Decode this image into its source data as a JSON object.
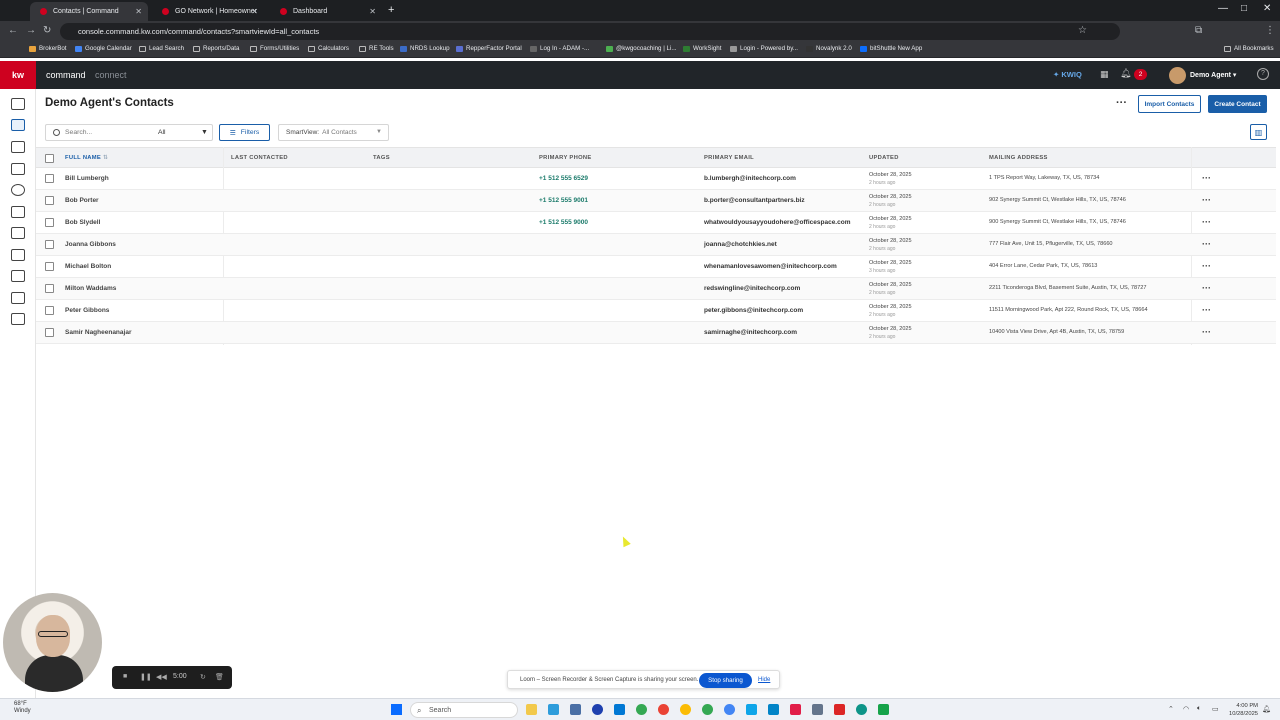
{
  "browser": {
    "tabs": [
      {
        "label": "Contacts | Command",
        "active": true
      },
      {
        "label": "GO Network | Homeowner",
        "active": false
      },
      {
        "label": "Dashboard",
        "active": false
      }
    ],
    "url": "console.command.kw.com/command/contacts?smartviewId=all_contacts",
    "bookmarks": [
      "BrokerBot",
      "Google Calendar",
      "Lead Search",
      "Reports/Data",
      "Forms/Utilities",
      "Calculators",
      "RE Tools",
      "NRDS Lookup",
      "RepperFactor Portal",
      "Log In - ADAM -...",
      "@kwgocoaching | Li...",
      "WorkSight",
      "Login - Powered by...",
      "Novalynk 2.0",
      "bitShuttle New App"
    ],
    "all_bookmarks": "All Bookmarks"
  },
  "app": {
    "logo": "kw",
    "brand_primary": "command",
    "brand_secondary": "connect",
    "kwiq": "KWIQ",
    "notifications": "2",
    "user": "Demo Agent"
  },
  "page": {
    "title": "Demo Agent's Contacts",
    "import_label": "Import Contacts",
    "create_label": "Create Contact",
    "search_placeholder": "Search...",
    "search_filter": "All",
    "filters_label": "Filters",
    "smartview_label": "SmartView:",
    "smartview_value": "All Contacts"
  },
  "table": {
    "headers": [
      "FULL NAME",
      "LAST CONTACTED",
      "TAGS",
      "PRIMARY PHONE",
      "PRIMARY EMAIL",
      "UPDATED",
      "MAILING ADDRESS"
    ],
    "rows": [
      {
        "name": "Bill Lumbergh",
        "phone": "+1 512 555 6529",
        "email": "b.lumbergh@initechcorp.com",
        "updated": "October 28, 2025",
        "updated_rel": "2 hours ago",
        "address": "1 TPS Report Way, Lakeway, TX, US, 78734"
      },
      {
        "name": "Bob Porter",
        "phone": "+1 512 555 9001",
        "email": "b.porter@consultantpartners.biz",
        "updated": "October 28, 2025",
        "updated_rel": "2 hours ago",
        "address": "902 Synergy Summit Ct, Westlake Hills, TX, US, 78746"
      },
      {
        "name": "Bob Slydell",
        "phone": "+1 512 555 9000",
        "email": "whatwouldyousayyoudohere@officespace.com",
        "updated": "October 28, 2025",
        "updated_rel": "2 hours ago",
        "address": "900 Synergy Summit Ct, Westlake Hills, TX, US, 78746"
      },
      {
        "name": "Joanna Gibbons",
        "phone": "",
        "email": "joanna@chotchkies.net",
        "updated": "October 28, 2025",
        "updated_rel": "2 hours ago",
        "address": "777 Flair Ave, Unit 15, Pflugerville, TX, US, 78660"
      },
      {
        "name": "Michael Bolton",
        "phone": "",
        "email": "whenamanlovesawomen@initechcorp.com",
        "updated": "October 28, 2025",
        "updated_rel": "3 hours ago",
        "address": "404 Error Lane, Cedar Park, TX, US, 78613"
      },
      {
        "name": "Milton Waddams",
        "phone": "",
        "email": "redswingline@initechcorp.com",
        "updated": "October 28, 2025",
        "updated_rel": "2 hours ago",
        "address": "2211 Ticonderoga Blvd, Basement Suite, Austin, TX, US, 78727"
      },
      {
        "name": "Peter Gibbons",
        "phone": "",
        "email": "peter.gibbons@initechcorp.com",
        "updated": "October 28, 2025",
        "updated_rel": "2 hours ago",
        "address": "11511 Morningwood Park, Apt 222, Round Rock, TX, US, 78664"
      },
      {
        "name": "Samir Nagheenanajar",
        "phone": "",
        "email": "samirnaghe@initechcorp.com",
        "updated": "October 28, 2025",
        "updated_rel": "2 hours ago",
        "address": "10400 Vista View Drive, Apt 4B, Austin, TX, US, 78759"
      }
    ]
  },
  "loom": {
    "timer": "5:00",
    "sharing_text": "Loom – Screen Recorder & Screen Capture is sharing your screen.",
    "stop_label": "Stop sharing",
    "hide_label": "Hide"
  },
  "taskbar": {
    "temp": "68°F",
    "weather": "Windy",
    "search": "Search",
    "time": "4:00 PM",
    "date": "10/28/2025"
  },
  "colors": {
    "kw_red": "#ce011f",
    "accent_blue": "#1a5ea8",
    "phone_teal": "#1a7a6a"
  }
}
